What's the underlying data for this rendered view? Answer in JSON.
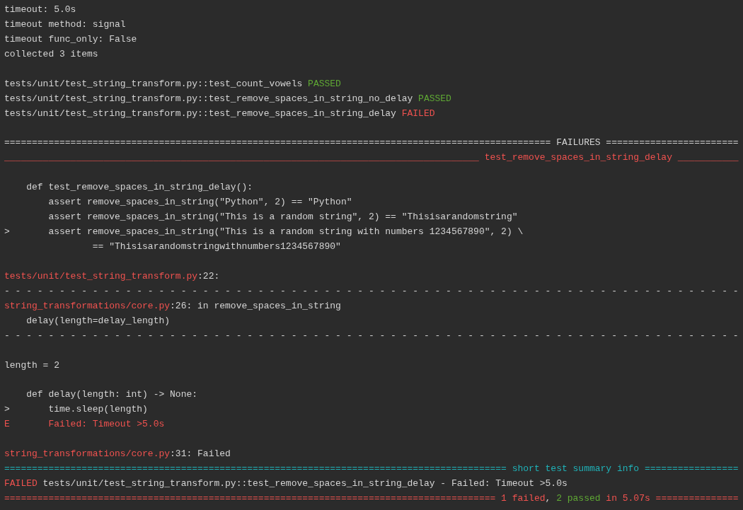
{
  "terminal": {
    "lines": [
      {
        "kind": "text",
        "segments": [
          {
            "text": "timeout: 5.0s",
            "color": "#d4d4d4"
          }
        ]
      },
      {
        "kind": "text",
        "segments": [
          {
            "text": "timeout method: signal",
            "color": "#d4d4d4"
          }
        ]
      },
      {
        "kind": "text",
        "segments": [
          {
            "text": "timeout func_only: False",
            "color": "#d4d4d4"
          }
        ]
      },
      {
        "kind": "text",
        "segments": [
          {
            "text": "collected 3 items",
            "color": "#d4d4d4"
          }
        ]
      },
      {
        "kind": "blank"
      },
      {
        "kind": "text",
        "segments": [
          {
            "text": "tests/unit/test_string_transform.py::test_count_vowels ",
            "color": "#d4d4d4"
          },
          {
            "text": "PASSED",
            "color": "#5fa834"
          }
        ]
      },
      {
        "kind": "text",
        "segments": [
          {
            "text": "tests/unit/test_string_transform.py::test_remove_spaces_in_string_no_delay ",
            "color": "#d4d4d4"
          },
          {
            "text": "PASSED",
            "color": "#5fa834"
          }
        ]
      },
      {
        "kind": "text",
        "segments": [
          {
            "text": "tests/unit/test_string_transform.py::test_remove_spaces_in_string_delay ",
            "color": "#d4d4d4"
          },
          {
            "text": "FAILED",
            "color": "#f0524f"
          }
        ]
      },
      {
        "kind": "blank"
      },
      {
        "kind": "text",
        "segments": [
          {
            "text": "=================================================================================================== FAILURES ========================",
            "color": "#d4d4d4"
          }
        ]
      },
      {
        "kind": "text",
        "segments": [
          {
            "text": "______________________________________________________________________________________ test_remove_spaces_in_string_delay ___________",
            "color": "#f0524f"
          }
        ]
      },
      {
        "kind": "blank"
      },
      {
        "kind": "text",
        "segments": [
          {
            "text": "    def test_remove_spaces_in_string_delay():",
            "color": "#d4d4d4"
          }
        ]
      },
      {
        "kind": "text",
        "segments": [
          {
            "text": "        assert remove_spaces_in_string(\"Python\", 2) == \"Python\"",
            "color": "#d4d4d4"
          }
        ]
      },
      {
        "kind": "text",
        "segments": [
          {
            "text": "        assert remove_spaces_in_string(\"This is a random string\", 2) == \"Thisisarandomstring\"",
            "color": "#d4d4d4"
          }
        ]
      },
      {
        "kind": "text",
        "segments": [
          {
            "text": ">       assert remove_spaces_in_string(\"This is a random string with numbers 1234567890\", 2) \\",
            "color": "#d4d4d4"
          }
        ]
      },
      {
        "kind": "text",
        "segments": [
          {
            "text": "                == \"Thisisarandomstringwithnumbers1234567890\"",
            "color": "#d4d4d4"
          }
        ]
      },
      {
        "kind": "blank"
      },
      {
        "kind": "text",
        "segments": [
          {
            "text": "tests/unit/test_string_transform.py",
            "color": "#f0524f"
          },
          {
            "text": ":22:",
            "color": "#d4d4d4"
          }
        ]
      },
      {
        "kind": "text",
        "segments": [
          {
            "text": "- - - - - - - - - - - - - - - - - - - - - - - - - - - - - - - - - - - - - - - - - - - - - - - - - - - - - - - - - - - - - - - - - - -",
            "color": "#d4d4d4"
          }
        ]
      },
      {
        "kind": "text",
        "segments": [
          {
            "text": "string_transformations/core.py",
            "color": "#f0524f"
          },
          {
            "text": ":26: in remove_spaces_in_string",
            "color": "#d4d4d4"
          }
        ]
      },
      {
        "kind": "text",
        "segments": [
          {
            "text": "    delay(length=delay_length)",
            "color": "#d4d4d4"
          }
        ]
      },
      {
        "kind": "text",
        "segments": [
          {
            "text": "- - - - - - - - - - - - - - - - - - - - - - - - - - - - - - - - - - - - - - - - - - - - - - - - - - - - - - - - - - - - - - - - - - -",
            "color": "#d4d4d4"
          }
        ]
      },
      {
        "kind": "blank"
      },
      {
        "kind": "text",
        "segments": [
          {
            "text": "length = 2",
            "color": "#d4d4d4"
          }
        ]
      },
      {
        "kind": "blank"
      },
      {
        "kind": "text",
        "segments": [
          {
            "text": "    def delay(length: int) -> None:",
            "color": "#d4d4d4"
          }
        ]
      },
      {
        "kind": "text",
        "segments": [
          {
            "text": ">       time.sleep(length)",
            "color": "#d4d4d4"
          }
        ]
      },
      {
        "kind": "text",
        "segments": [
          {
            "text": "E       Failed: Timeout >5.0s",
            "color": "#f0524f"
          }
        ]
      },
      {
        "kind": "blank"
      },
      {
        "kind": "text",
        "segments": [
          {
            "text": "string_transformations/core.py",
            "color": "#f0524f"
          },
          {
            "text": ":31: Failed",
            "color": "#d4d4d4"
          }
        ]
      },
      {
        "kind": "text",
        "segments": [
          {
            "text": "=========================================================================================== short test summary info =================",
            "color": "#1fb2b8"
          }
        ]
      },
      {
        "kind": "text",
        "segments": [
          {
            "text": "FAILED",
            "color": "#f0524f"
          },
          {
            "text": " tests/unit/test_string_transform.py::test_remove_spaces_in_string_delay - Failed: Timeout >5.0s",
            "color": "#d4d4d4"
          }
        ]
      },
      {
        "kind": "text",
        "segments": [
          {
            "text": "========================================================================================= 1 failed",
            "color": "#f0524f"
          },
          {
            "text": ", "
          },
          {
            "text": "2 passed",
            "color": "#5fa834"
          },
          {
            "text": " in 5.07s ===============",
            "color": "#f0524f"
          }
        ]
      }
    ]
  }
}
